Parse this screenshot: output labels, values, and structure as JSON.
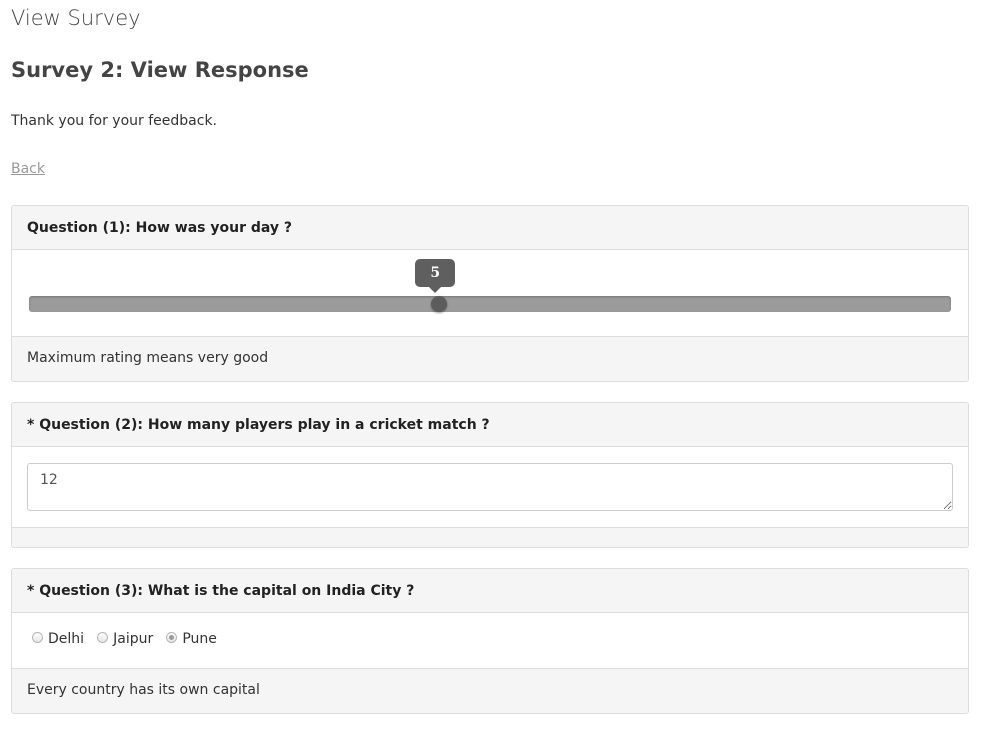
{
  "page": {
    "heading": "View Survey",
    "survey_title": "Survey 2: View Response",
    "thanks": "Thank you for your feedback.",
    "back_label": "Back"
  },
  "questions": [
    {
      "title": "Question (1): How was your day ?",
      "type": "rating-slider",
      "value": "5",
      "slider_fraction": 0.445,
      "footer": "Maximum rating means very good"
    },
    {
      "title": "* Question (2): How many players play in a cricket match ?",
      "type": "textarea",
      "answer": "12",
      "footer": ""
    },
    {
      "title": "* Question (3): What is the capital on India City ?",
      "type": "radio",
      "options": [
        {
          "label": "Delhi",
          "checked": false
        },
        {
          "label": "Jaipur",
          "checked": false
        },
        {
          "label": "Pune",
          "checked": true
        }
      ],
      "footer": "Every country has its own capital"
    }
  ],
  "colors": {
    "panel_heading_bg": "#f5f5f5",
    "border": "#dddddd",
    "slider_track": "#9b9b9b",
    "slider_handle": "#5c5c5c"
  }
}
